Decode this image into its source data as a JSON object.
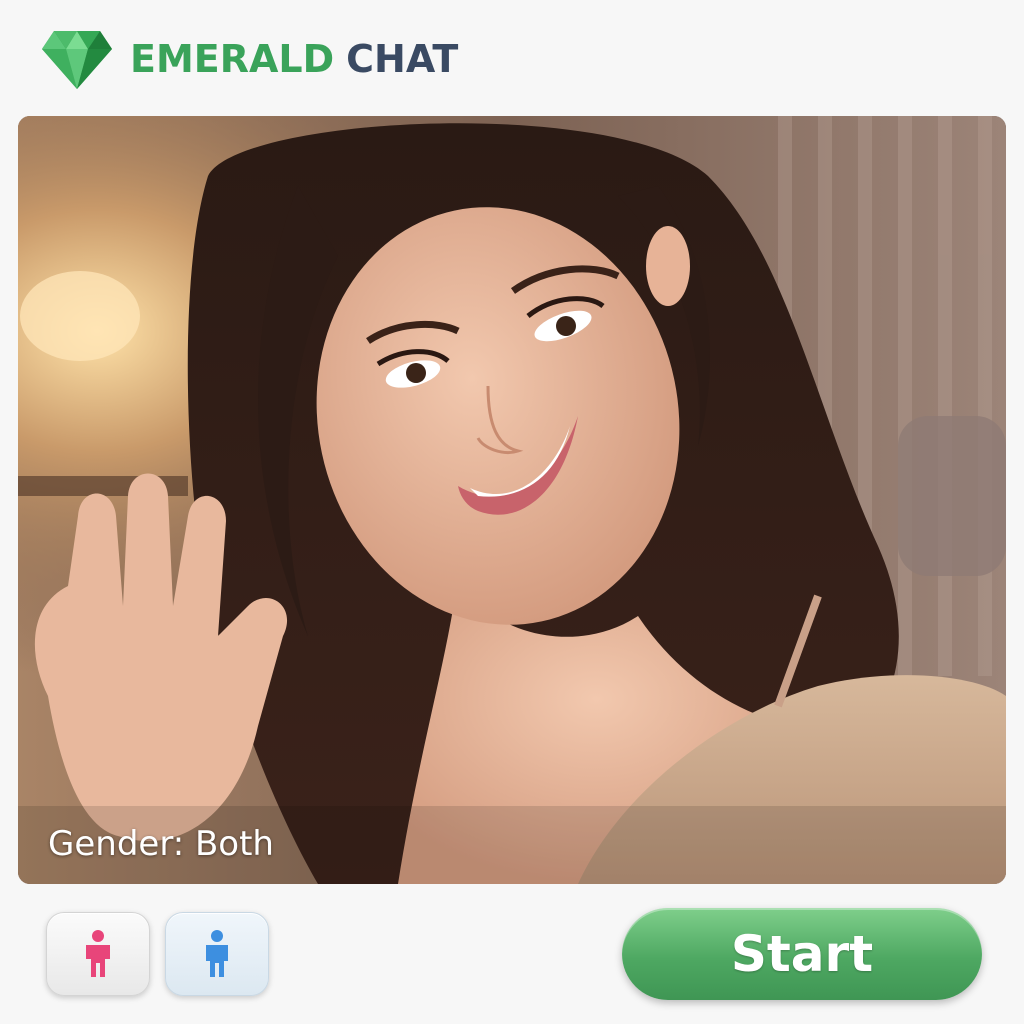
{
  "header": {
    "brand_primary": "EMERALD",
    "brand_secondary": "CHAT",
    "logo_icon": "emerald-gem-icon"
  },
  "video": {
    "overlay_label": "Gender: Both"
  },
  "controls": {
    "female_icon": "female-person-icon",
    "male_icon": "male-person-icon",
    "start_label": "Start"
  },
  "colors": {
    "brand_green": "#3aa35a",
    "brand_dark": "#3a4a63",
    "female_pink": "#e8457a",
    "male_blue": "#3d8fe0",
    "start_green": "#4ea862"
  }
}
